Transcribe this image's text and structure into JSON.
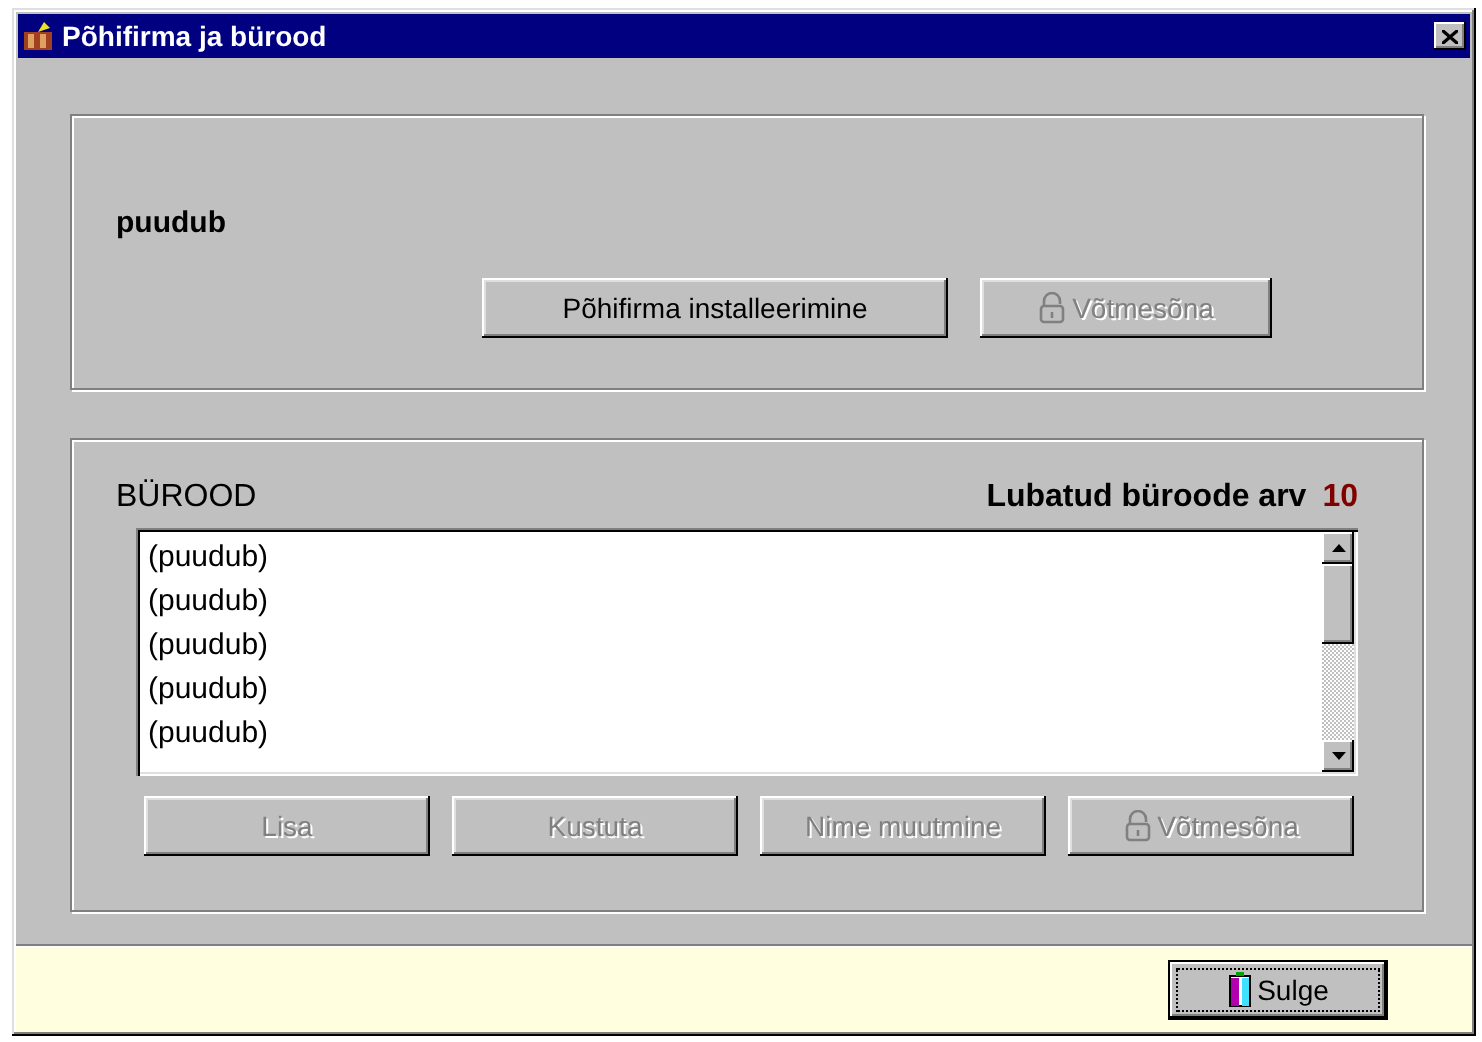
{
  "window": {
    "title": "Põhifirma ja bürood"
  },
  "main_firm": {
    "name": "puudub",
    "buttons": [
      {
        "label": "Põhifirma installeerimine",
        "disabled": false,
        "kind": "text"
      },
      {
        "label": "Võtmesõna",
        "disabled": true,
        "kind": "lock"
      }
    ]
  },
  "offices": {
    "heading": "BÜROOD",
    "limit_label": "Lubatud büroode arv",
    "limit_value": "10",
    "items": [
      "(puudub)",
      "(puudub)",
      "(puudub)",
      "(puudub)",
      "(puudub)"
    ],
    "buttons": [
      {
        "label": "Lisa",
        "disabled": true,
        "kind": "text"
      },
      {
        "label": "Kustuta",
        "disabled": true,
        "kind": "text"
      },
      {
        "label": "Nime muutmine",
        "disabled": true,
        "kind": "text"
      },
      {
        "label": "Võtmesõna",
        "disabled": true,
        "kind": "lock"
      }
    ]
  },
  "footer": {
    "close_button": {
      "label": "Sulge",
      "disabled": false,
      "kind": "door"
    }
  }
}
